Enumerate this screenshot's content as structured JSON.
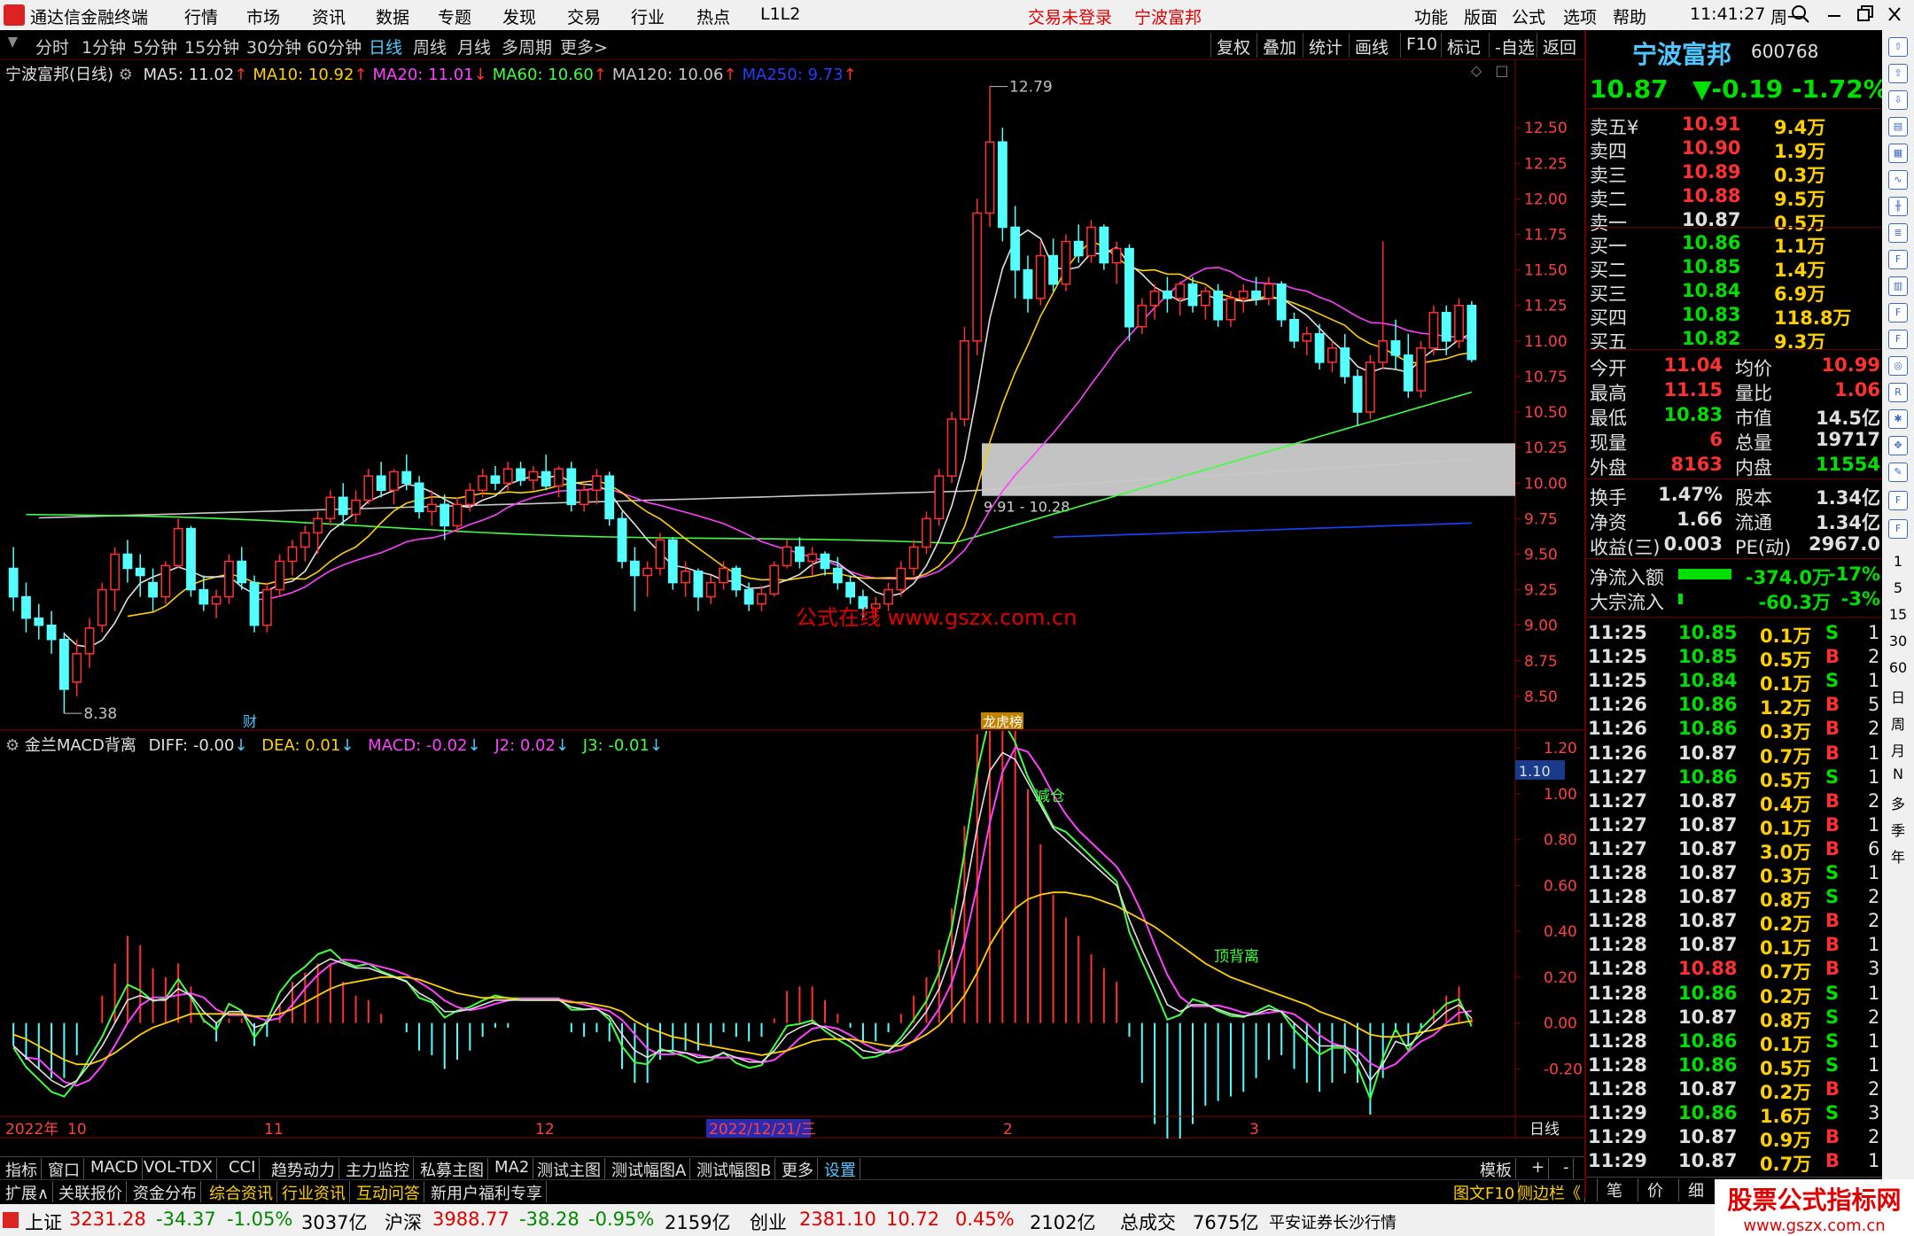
{
  "menubar": {
    "app_title": "通达信金融终端",
    "items": [
      "行情",
      "市场",
      "资讯",
      "数据",
      "专题",
      "发现",
      "交易",
      "行业",
      "热点",
      "L1L2"
    ],
    "trade_status": "交易未登录",
    "stock_name": "宁波富邦",
    "right_items": [
      "功能",
      "版面",
      "公式",
      "选项",
      "帮助"
    ],
    "time": "11:41:27",
    "weekday": "周一"
  },
  "toolbar": {
    "periods": [
      "分时",
      "1分钟",
      "5分钟",
      "15分钟",
      "30分钟",
      "60分钟",
      "日线",
      "周线",
      "月线",
      "多周期",
      "更多>"
    ],
    "active": "日线",
    "right": [
      "复权",
      "叠加",
      "统计",
      "画线",
      "F10",
      "标记",
      "-自选",
      "返回"
    ]
  },
  "main_chart": {
    "title": "宁波富邦(日线)",
    "ma": [
      {
        "label": "MA5: 11.02",
        "color": "#e0e0e0",
        "arrow": "↑"
      },
      {
        "label": "MA10: 10.92",
        "color": "#ffd000",
        "arrow": "↑"
      },
      {
        "label": "MA20: 11.01",
        "color": "#ff40ff",
        "arrow": "↓"
      },
      {
        "label": "MA60: 10.60",
        "color": "#40ff40",
        "arrow": "↑"
      },
      {
        "label": "MA120: 10.06",
        "color": "#c8c8c8",
        "arrow": "↑"
      },
      {
        "label": "MA250: 9.73",
        "color": "#2040ff",
        "arrow": "↑"
      }
    ],
    "y_ticks": [
      "12.50",
      "12.25",
      "12.00",
      "11.75",
      "11.50",
      "11.25",
      "11.00",
      "10.75",
      "10.50",
      "10.25",
      "10.00",
      "9.75",
      "9.50",
      "9.25",
      "9.00",
      "8.75",
      "8.50"
    ],
    "high_label": "12.79",
    "low_label": "8.38",
    "range_label": "9.91 - 10.28",
    "watermark": "公式在线  www.gszx.com.cn",
    "marker_cai": "财",
    "marker_long": "龙虎榜"
  },
  "chart_data": {
    "type": "candlestick",
    "y_range": [
      8.3,
      12.9
    ],
    "ohlc": [
      [
        9.4,
        9.55,
        9.1,
        9.2
      ],
      [
        9.2,
        9.3,
        8.95,
        9.05
      ],
      [
        9.05,
        9.15,
        8.9,
        9.0
      ],
      [
        9.0,
        9.1,
        8.8,
        8.9
      ],
      [
        8.9,
        8.95,
        8.38,
        8.55
      ],
      [
        8.6,
        8.9,
        8.5,
        8.8
      ],
      [
        8.8,
        9.05,
        8.7,
        8.98
      ],
      [
        9.0,
        9.3,
        8.95,
        9.25
      ],
      [
        9.25,
        9.55,
        9.1,
        9.5
      ],
      [
        9.5,
        9.6,
        9.3,
        9.4
      ],
      [
        9.4,
        9.5,
        9.2,
        9.35
      ],
      [
        9.3,
        9.4,
        9.1,
        9.2
      ],
      [
        9.2,
        9.45,
        9.15,
        9.42
      ],
      [
        9.42,
        9.75,
        9.4,
        9.68
      ],
      [
        9.68,
        9.7,
        9.2,
        9.25
      ],
      [
        9.25,
        9.35,
        9.1,
        9.15
      ],
      [
        9.15,
        9.25,
        9.05,
        9.2
      ],
      [
        9.2,
        9.5,
        9.15,
        9.45
      ],
      [
        9.45,
        9.55,
        9.25,
        9.3
      ],
      [
        9.3,
        9.35,
        8.95,
        9.0
      ],
      [
        9.0,
        9.3,
        8.95,
        9.25
      ],
      [
        9.25,
        9.5,
        9.2,
        9.45
      ],
      [
        9.45,
        9.6,
        9.35,
        9.55
      ],
      [
        9.55,
        9.7,
        9.45,
        9.65
      ],
      [
        9.65,
        9.8,
        9.5,
        9.75
      ],
      [
        9.75,
        9.95,
        9.7,
        9.9
      ],
      [
        9.9,
        10.0,
        9.7,
        9.78
      ],
      [
        9.78,
        9.95,
        9.72,
        9.88
      ],
      [
        9.88,
        10.1,
        9.85,
        10.05
      ],
      [
        10.05,
        10.15,
        9.9,
        9.95
      ],
      [
        9.95,
        10.1,
        9.85,
        10.08
      ],
      [
        10.08,
        10.2,
        9.95,
        10.0
      ],
      [
        10.0,
        10.05,
        9.75,
        9.8
      ],
      [
        9.8,
        9.95,
        9.7,
        9.85
      ],
      [
        9.85,
        9.92,
        9.6,
        9.7
      ],
      [
        9.7,
        9.9,
        9.65,
        9.85
      ],
      [
        9.85,
        10.0,
        9.8,
        9.95
      ],
      [
        9.95,
        10.1,
        9.9,
        10.05
      ],
      [
        10.05,
        10.12,
        9.95,
        10.0
      ],
      [
        10.0,
        10.15,
        9.95,
        10.1
      ],
      [
        10.1,
        10.15,
        9.98,
        10.02
      ],
      [
        10.02,
        10.12,
        9.95,
        10.08
      ],
      [
        10.08,
        10.2,
        9.95,
        9.98
      ],
      [
        9.98,
        10.12,
        9.9,
        10.1
      ],
      [
        10.1,
        10.15,
        9.8,
        9.85
      ],
      [
        9.85,
        10.0,
        9.8,
        9.95
      ],
      [
        9.95,
        10.1,
        9.85,
        10.05
      ],
      [
        10.05,
        10.08,
        9.7,
        9.75
      ],
      [
        9.75,
        9.8,
        9.4,
        9.45
      ],
      [
        9.45,
        9.55,
        9.1,
        9.35
      ],
      [
        9.35,
        9.45,
        9.2,
        9.4
      ],
      [
        9.4,
        9.65,
        9.35,
        9.6
      ],
      [
        9.6,
        9.62,
        9.25,
        9.3
      ],
      [
        9.3,
        9.45,
        9.2,
        9.38
      ],
      [
        9.38,
        9.4,
        9.1,
        9.2
      ],
      [
        9.2,
        9.35,
        9.15,
        9.3
      ],
      [
        9.3,
        9.45,
        9.25,
        9.4
      ],
      [
        9.4,
        9.42,
        9.2,
        9.25
      ],
      [
        9.25,
        9.3,
        9.1,
        9.15
      ],
      [
        9.15,
        9.28,
        9.1,
        9.22
      ],
      [
        9.22,
        9.45,
        9.2,
        9.42
      ],
      [
        9.42,
        9.6,
        9.4,
        9.55
      ],
      [
        9.55,
        9.62,
        9.4,
        9.45
      ],
      [
        9.45,
        9.55,
        9.35,
        9.5
      ],
      [
        9.5,
        9.52,
        9.35,
        9.4
      ],
      [
        9.4,
        9.48,
        9.25,
        9.3
      ],
      [
        9.3,
        9.35,
        9.15,
        9.2
      ],
      [
        9.2,
        9.25,
        9.05,
        9.12
      ],
      [
        9.12,
        9.2,
        9.05,
        9.15
      ],
      [
        9.15,
        9.3,
        9.1,
        9.25
      ],
      [
        9.25,
        9.45,
        9.2,
        9.4
      ],
      [
        9.4,
        9.6,
        9.35,
        9.55
      ],
      [
        9.55,
        9.8,
        9.5,
        9.75
      ],
      [
        9.75,
        10.1,
        9.7,
        10.05
      ],
      [
        10.05,
        10.5,
        10.0,
        10.45
      ],
      [
        10.45,
        11.1,
        10.4,
        11.0
      ],
      [
        11.0,
        12.0,
        10.9,
        11.9
      ],
      [
        11.9,
        12.79,
        11.8,
        12.4
      ],
      [
        12.4,
        12.5,
        11.7,
        11.8
      ],
      [
        11.8,
        11.95,
        11.3,
        11.5
      ],
      [
        11.5,
        11.6,
        11.2,
        11.3
      ],
      [
        11.3,
        11.7,
        11.25,
        11.6
      ],
      [
        11.6,
        11.72,
        11.35,
        11.4
      ],
      [
        11.4,
        11.75,
        11.35,
        11.7
      ],
      [
        11.7,
        11.82,
        11.55,
        11.6
      ],
      [
        11.6,
        11.85,
        11.55,
        11.8
      ],
      [
        11.8,
        11.82,
        11.5,
        11.55
      ],
      [
        11.55,
        11.7,
        11.4,
        11.65
      ],
      [
        11.65,
        11.68,
        11.0,
        11.1
      ],
      [
        11.1,
        11.3,
        11.05,
        11.25
      ],
      [
        11.25,
        11.4,
        11.15,
        11.35
      ],
      [
        11.35,
        11.45,
        11.2,
        11.3
      ],
      [
        11.3,
        11.42,
        11.18,
        11.4
      ],
      [
        11.4,
        11.45,
        11.2,
        11.25
      ],
      [
        11.25,
        11.38,
        11.15,
        11.35
      ],
      [
        11.35,
        11.4,
        11.1,
        11.15
      ],
      [
        11.15,
        11.35,
        11.1,
        11.3
      ],
      [
        11.3,
        11.4,
        11.2,
        11.35
      ],
      [
        11.35,
        11.45,
        11.25,
        11.3
      ],
      [
        11.3,
        11.45,
        11.25,
        11.4
      ],
      [
        11.4,
        11.42,
        11.1,
        11.15
      ],
      [
        11.15,
        11.2,
        10.95,
        11.0
      ],
      [
        11.0,
        11.1,
        10.9,
        11.05
      ],
      [
        11.05,
        11.12,
        10.8,
        10.85
      ],
      [
        10.85,
        11.0,
        10.78,
        10.95
      ],
      [
        10.95,
        11.05,
        10.7,
        10.75
      ],
      [
        10.75,
        10.8,
        10.4,
        10.5
      ],
      [
        10.5,
        10.9,
        10.45,
        10.85
      ],
      [
        10.85,
        11.7,
        10.8,
        11.0
      ],
      [
        11.0,
        11.15,
        10.8,
        10.9
      ],
      [
        10.9,
        11.05,
        10.6,
        10.65
      ],
      [
        10.65,
        11.0,
        10.6,
        10.95
      ],
      [
        10.95,
        11.25,
        10.9,
        11.2
      ],
      [
        11.2,
        11.25,
        10.9,
        11.0
      ],
      [
        11.0,
        11.3,
        10.95,
        11.25
      ],
      [
        11.25,
        11.28,
        10.85,
        10.87
      ]
    ]
  },
  "macd_chart": {
    "title": "金兰MACD背离",
    "diff": "DIFF: -0.00",
    "dea": "DEA: 0.01",
    "macd": "MACD: -0.02",
    "j2": "J2: 0.02",
    "j3": "J3: -0.01",
    "y_ticks": [
      "1.20",
      "1.00",
      "0.80",
      "0.60",
      "0.40",
      "0.20",
      "0.00",
      "-0.20"
    ],
    "y_range": [
      -0.38,
      1.22
    ],
    "current": "1.10",
    "label_jiancang": "减仓",
    "label_dingbeili": "顶背离",
    "series_diff": [
      -0.1,
      -0.15,
      -0.2,
      -0.25,
      -0.28,
      -0.25,
      -0.18,
      -0.1,
      0.0,
      0.1,
      0.12,
      0.1,
      0.1,
      0.15,
      0.12,
      0.05,
      0.0,
      0.05,
      0.05,
      -0.02,
      0.0,
      0.08,
      0.15,
      0.2,
      0.25,
      0.28,
      0.26,
      0.24,
      0.24,
      0.22,
      0.2,
      0.18,
      0.13,
      0.1,
      0.05,
      0.05,
      0.06,
      0.08,
      0.1,
      0.1,
      0.1,
      0.1,
      0.1,
      0.1,
      0.07,
      0.06,
      0.06,
      0.03,
      -0.05,
      -0.12,
      -0.15,
      -0.12,
      -0.12,
      -0.13,
      -0.15,
      -0.15,
      -0.13,
      -0.15,
      -0.17,
      -0.17,
      -0.12,
      -0.05,
      -0.02,
      0.0,
      -0.02,
      -0.05,
      -0.08,
      -0.12,
      -0.13,
      -0.12,
      -0.08,
      -0.02,
      0.05,
      0.15,
      0.3,
      0.55,
      0.85,
      1.1,
      1.18,
      1.15,
      1.05,
      0.95,
      0.85,
      0.8,
      0.75,
      0.7,
      0.65,
      0.6,
      0.45,
      0.32,
      0.2,
      0.08,
      0.05,
      0.08,
      0.08,
      0.06,
      0.04,
      0.03,
      0.04,
      0.06,
      0.05,
      0.0,
      -0.05,
      -0.1,
      -0.1,
      -0.1,
      -0.15,
      -0.25,
      -0.18,
      -0.08,
      -0.1,
      -0.05,
      0.0,
      0.05,
      0.08,
      0.02
    ],
    "series_dea": [
      -0.05,
      -0.07,
      -0.1,
      -0.13,
      -0.16,
      -0.18,
      -0.18,
      -0.16,
      -0.13,
      -0.09,
      -0.05,
      -0.02,
      0.0,
      0.02,
      0.04,
      0.04,
      0.04,
      0.04,
      0.04,
      0.03,
      0.03,
      0.04,
      0.06,
      0.09,
      0.12,
      0.15,
      0.17,
      0.18,
      0.19,
      0.2,
      0.2,
      0.2,
      0.19,
      0.17,
      0.15,
      0.13,
      0.12,
      0.11,
      0.11,
      0.11,
      0.1,
      0.1,
      0.1,
      0.1,
      0.09,
      0.09,
      0.08,
      0.07,
      0.05,
      0.01,
      -0.02,
      -0.04,
      -0.06,
      -0.07,
      -0.09,
      -0.1,
      -0.11,
      -0.12,
      -0.13,
      -0.14,
      -0.13,
      -0.12,
      -0.1,
      -0.08,
      -0.07,
      -0.07,
      -0.07,
      -0.08,
      -0.09,
      -0.1,
      -0.1,
      -0.08,
      -0.05,
      -0.01,
      0.05,
      0.12,
      0.22,
      0.34,
      0.43,
      0.5,
      0.54,
      0.56,
      0.57,
      0.57,
      0.56,
      0.55,
      0.53,
      0.51,
      0.48,
      0.45,
      0.42,
      0.38,
      0.34,
      0.3,
      0.26,
      0.23,
      0.2,
      0.18,
      0.16,
      0.14,
      0.12,
      0.1,
      0.08,
      0.05,
      0.03,
      0.01,
      -0.02,
      -0.05,
      -0.06,
      -0.06,
      -0.05,
      -0.04,
      -0.03,
      -0.01,
      0.0,
      0.01
    ],
    "x_labels": [
      "2022年",
      "10",
      "11",
      "12",
      "2022/12/21/三",
      "2",
      "3",
      "日线"
    ]
  },
  "rpanel": {
    "name": "宁波富邦",
    "code": "600768",
    "price": "10.87",
    "change": "▼-0.19",
    "pct": "-1.72%",
    "sells": [
      {
        "label": "卖五¥",
        "price": "10.91",
        "vol": "9.4万"
      },
      {
        "label": "卖四",
        "price": "10.90",
        "vol": "1.9万"
      },
      {
        "label": "卖三",
        "price": "10.89",
        "vol": "0.3万"
      },
      {
        "label": "卖二",
        "price": "10.88",
        "vol": "9.5万"
      },
      {
        "label": "卖一",
        "price": "10.87",
        "vol": "0.5万"
      }
    ],
    "buys": [
      {
        "label": "买一",
        "price": "10.86",
        "vol": "1.1万"
      },
      {
        "label": "买二",
        "price": "10.85",
        "vol": "1.4万"
      },
      {
        "label": "买三",
        "price": "10.84",
        "vol": "6.9万"
      },
      {
        "label": "买四",
        "price": "10.83",
        "vol": "118.8万"
      },
      {
        "label": "买五",
        "price": "10.82",
        "vol": "9.3万"
      }
    ],
    "stats": [
      [
        "今开",
        "11.04",
        "redc",
        "均价",
        "10.99",
        "redc"
      ],
      [
        "最高",
        "11.15",
        "redc",
        "量比",
        "1.06",
        "redc"
      ],
      [
        "最低",
        "10.83",
        "green",
        "市值",
        "14.5亿",
        "wht"
      ],
      [
        "现量",
        "6",
        "redc",
        "总量",
        "19717",
        "wht"
      ],
      [
        "外盘",
        "8163",
        "redc",
        "内盘",
        "11554",
        "green"
      ]
    ],
    "stats2": [
      [
        "换手",
        "1.47%",
        "wht",
        "股本",
        "1.34亿",
        "wht"
      ],
      [
        "净资",
        "1.66",
        "wht",
        "流通",
        "1.34亿",
        "wht"
      ],
      [
        "收益(三)",
        "0.003",
        "wht",
        "PE(动)",
        "2967.0",
        "wht"
      ]
    ],
    "flow": [
      {
        "label": "净流入额",
        "val": "-374.0万",
        "pct": "-17%",
        "bar": 0.6
      },
      {
        "label": "大宗流入",
        "val": "-60.3万",
        "pct": "-3%",
        "bar": 0.05
      }
    ],
    "ticks": [
      [
        "11:25",
        "10.85",
        "0.1万",
        "S",
        "1"
      ],
      [
        "11:25",
        "10.85",
        "0.5万",
        "B",
        "2"
      ],
      [
        "11:25",
        "10.84",
        "0.1万",
        "S",
        "1"
      ],
      [
        "11:26",
        "10.86",
        "1.2万",
        "B",
        "5"
      ],
      [
        "11:26",
        "10.86",
        "0.3万",
        "B",
        "2"
      ],
      [
        "11:26",
        "10.87",
        "0.7万",
        "B",
        "1"
      ],
      [
        "11:27",
        "10.86",
        "0.5万",
        "S",
        "1"
      ],
      [
        "11:27",
        "10.87",
        "0.4万",
        "B",
        "2"
      ],
      [
        "11:27",
        "10.87",
        "0.1万",
        "B",
        "1"
      ],
      [
        "11:27",
        "10.87",
        "3.0万",
        "B",
        "6"
      ],
      [
        "11:28",
        "10.87",
        "0.3万",
        "S",
        "1"
      ],
      [
        "11:28",
        "10.87",
        "0.8万",
        "S",
        "2"
      ],
      [
        "11:28",
        "10.87",
        "0.2万",
        "B",
        "2"
      ],
      [
        "11:28",
        "10.87",
        "0.1万",
        "B",
        "1"
      ],
      [
        "11:28",
        "10.88",
        "0.7万",
        "B",
        "3"
      ],
      [
        "11:28",
        "10.86",
        "0.2万",
        "S",
        "1"
      ],
      [
        "11:28",
        "10.87",
        "0.8万",
        "S",
        "2"
      ],
      [
        "11:28",
        "10.86",
        "0.1万",
        "S",
        "1"
      ],
      [
        "11:28",
        "10.86",
        "0.5万",
        "S",
        "1"
      ],
      [
        "11:28",
        "10.87",
        "0.2万",
        "B",
        "2"
      ],
      [
        "11:29",
        "10.86",
        "1.6万",
        "S",
        "3"
      ],
      [
        "11:29",
        "10.87",
        "0.9万",
        "B",
        "2"
      ],
      [
        "11:29",
        "10.87",
        "0.7万",
        "B",
        "1"
      ]
    ],
    "bottom_tabs": [
      "笔",
      "价",
      "细",
      "盘"
    ]
  },
  "iconbar": {
    "icons": [
      "up-arrow-icon",
      "up-arrow-icon",
      "down-arrow-icon",
      "chart-icon",
      "grid-icon",
      "line-icon",
      "kline-icon",
      "doc-icon",
      "f10-icon",
      "news-icon",
      "f2-icon",
      "f3-icon",
      "circle-icon",
      "rsi-icon",
      "star-icon",
      "move-icon",
      "pen-icon",
      "f5-icon",
      "f6-icon"
    ],
    "labels": [
      "1",
      "5",
      "15",
      "30",
      "60",
      "日",
      "周",
      "月",
      "N",
      "多",
      "季",
      "年"
    ]
  },
  "tabs1": [
    "指标",
    "窗口",
    "MACD",
    "VOL-TDX",
    "CCI",
    "趋势动力",
    "主力监控",
    "私募主图",
    "MA2",
    "测试主图",
    "测试幅图A",
    "测试幅图B",
    "更多",
    "设置"
  ],
  "tabs1_right": [
    "模板",
    "+",
    "-"
  ],
  "tabs2": [
    "扩展∧",
    "关联报价",
    "资金分布",
    "综合资讯",
    "行业资讯",
    "互动问答",
    "新用户福利专享"
  ],
  "tabs2_right": [
    "图文F10",
    "侧边栏《"
  ],
  "status": {
    "sh": [
      "上证",
      "3231.28",
      "-34.37",
      "-1.05%",
      "3037亿"
    ],
    "sz": [
      "沪深",
      "3988.77",
      "-38.28",
      "-0.95%",
      "2159亿"
    ],
    "cy": [
      "创业",
      "2381.10",
      "10.72",
      "0.45%",
      "2102亿"
    ],
    "total": [
      "总成交",
      "7675亿"
    ],
    "broker": "平安证券长沙行情",
    "brand": "股票公式指标网",
    "brand_url": "www.gszx.com.cn"
  }
}
